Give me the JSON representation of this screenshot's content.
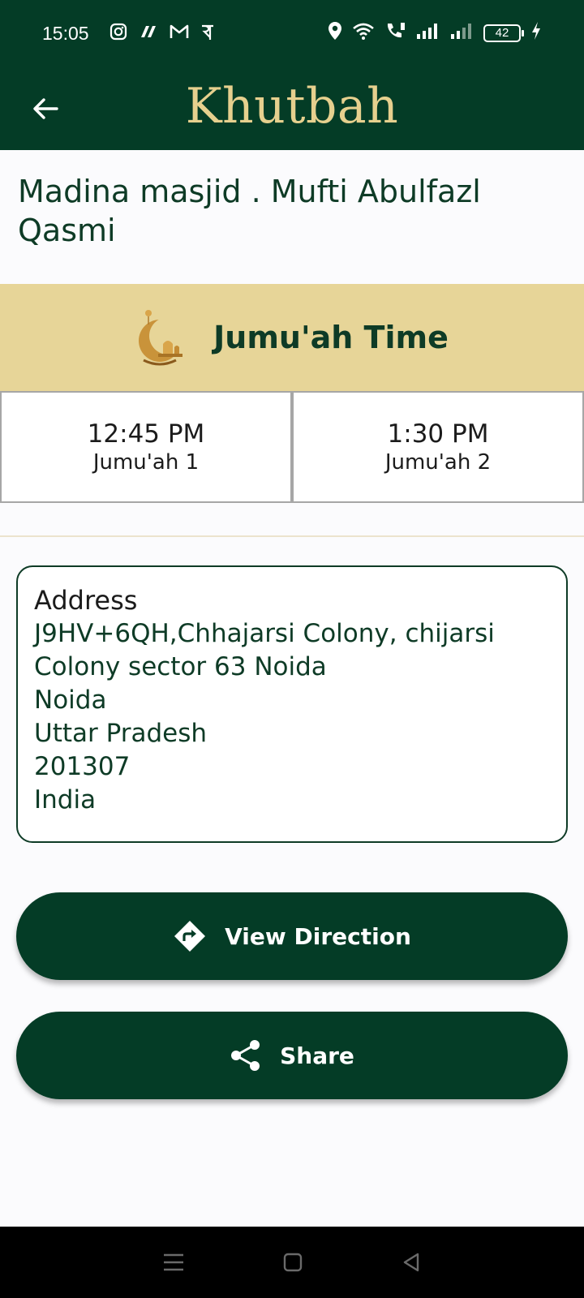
{
  "status_bar": {
    "time": "15:05",
    "battery": "42",
    "app_icons": [
      "instagram-icon",
      "app-icon",
      "gmail-icon",
      "phonepe-icon"
    ],
    "system_icons": [
      "location-icon",
      "wifi-icon",
      "volte-call-icon",
      "signal-icon",
      "signal-icon",
      "battery-icon",
      "charging-icon"
    ]
  },
  "app_bar": {
    "title": "Khutbah",
    "back_icon": "arrow-left-icon"
  },
  "mosque": {
    "name": "Madina masjid . Mufti Abulfazl Qasmi"
  },
  "jumuah": {
    "title": "Jumu'ah Time",
    "icon": "crescent-lantern-icon",
    "times": [
      {
        "time": "12:45 PM",
        "label": "Jumu'ah 1"
      },
      {
        "time": "1:30 PM",
        "label": "Jumu'ah 2"
      }
    ]
  },
  "address": {
    "heading": "Address",
    "lines": [
      "J9HV+6QH,Chhajarsi Colony, chijarsi",
      "Colony sector 63 Noida",
      "Noida",
      "Uttar Pradesh",
      "201307",
      "India"
    ]
  },
  "actions": {
    "view_direction": "View Direction",
    "share": "Share"
  },
  "colors": {
    "primary": "#043c26",
    "accent_gold": "#e6d08e",
    "banner": "#e7d598"
  },
  "nav_bar": [
    "menu-icon",
    "home-square-icon",
    "back-triangle-icon"
  ]
}
